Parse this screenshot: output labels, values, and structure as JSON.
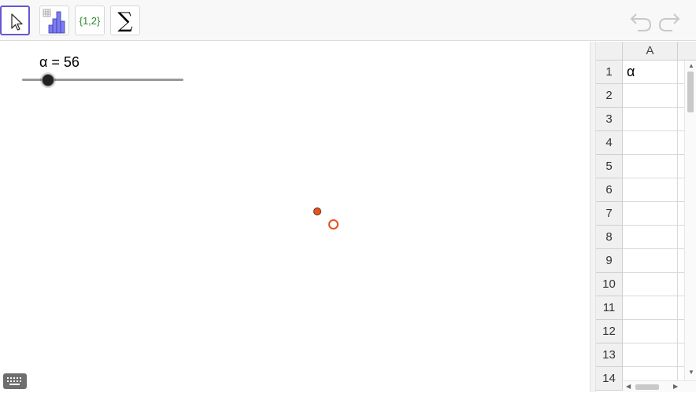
{
  "toolbar": {
    "tools": [
      {
        "name": "move-tool",
        "icon": "cursor-arrow-icon",
        "selected": true
      },
      {
        "name": "analysis-tool",
        "icon": "bar-chart-icon",
        "selected": false
      },
      {
        "name": "list-tool",
        "icon": "list-icon",
        "label": "{1,2}",
        "selected": false
      },
      {
        "name": "sum-tool",
        "icon": "sigma-icon",
        "label": "∑",
        "selected": false
      }
    ],
    "undo_icon": "undo-icon",
    "redo_icon": "redo-icon"
  },
  "graphics": {
    "slider": {
      "label": "α = 56",
      "value": 56
    },
    "keyboard_icon": "keyboard-icon",
    "point_color": "#e8531d"
  },
  "spreadsheet": {
    "column_header": "A",
    "rows": [
      {
        "row": "1",
        "A": "α"
      },
      {
        "row": "2",
        "A": ""
      },
      {
        "row": "3",
        "A": ""
      },
      {
        "row": "4",
        "A": ""
      },
      {
        "row": "5",
        "A": ""
      },
      {
        "row": "6",
        "A": ""
      },
      {
        "row": "7",
        "A": ""
      },
      {
        "row": "8",
        "A": ""
      },
      {
        "row": "9",
        "A": ""
      },
      {
        "row": "10",
        "A": ""
      },
      {
        "row": "11",
        "A": ""
      },
      {
        "row": "12",
        "A": ""
      },
      {
        "row": "13",
        "A": ""
      },
      {
        "row": "14",
        "A": ""
      }
    ]
  },
  "colors": {
    "accent": "#6557d2",
    "list_text": "#2e8b2e"
  }
}
